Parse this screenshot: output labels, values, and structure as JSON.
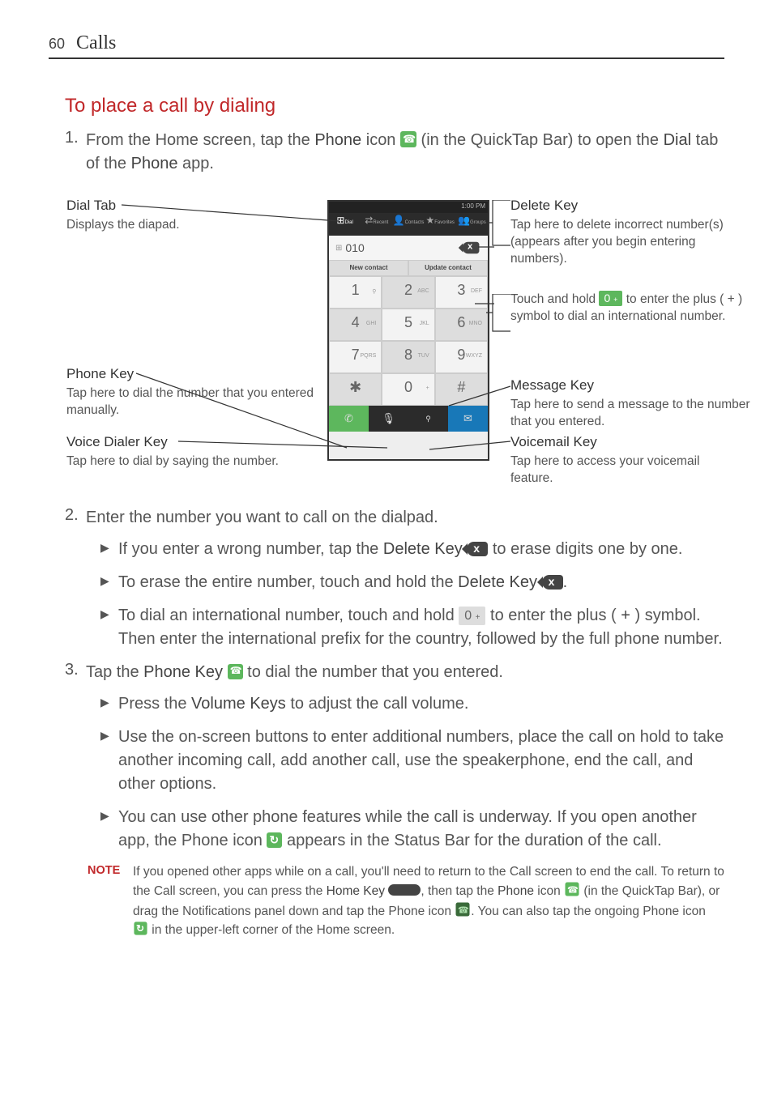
{
  "page": {
    "number": "60",
    "section": "Calls"
  },
  "heading": "To place a call by dialing",
  "step1": {
    "num": "1.",
    "pre": "From the Home screen, tap the ",
    "phone": "Phone",
    "mid": " icon ",
    "after_icon": " (in the QuickTap Bar) to open the ",
    "dial": "Dial",
    "mid2": " tab of the ",
    "phone2": "Phone",
    "end": " app."
  },
  "diagram": {
    "statusbar_time": "1:00 PM",
    "tabs": {
      "dial": "Dial",
      "recent": "Recent",
      "contacts": "Contacts",
      "favorites": "Favorites",
      "groups": "Groups"
    },
    "display_number": "010",
    "actions": {
      "new": "New contact",
      "update": "Update contact"
    },
    "keys": {
      "1": "1",
      "2": "2",
      "2s": "ABC",
      "3": "3",
      "3s": "DEF",
      "4": "4",
      "4s": "GHI",
      "5": "5",
      "5s": "JKL",
      "6": "6",
      "6s": "MNO",
      "7": "7",
      "7s": "PQRS",
      "8": "8",
      "8s": "TUV",
      "9": "9",
      "9s": "WXYZ",
      "star": "✱",
      "0": "0",
      "0s": "+",
      "hash": "#"
    }
  },
  "callouts": {
    "dial_tab": {
      "title": "Dial Tab",
      "desc": "Displays the diapad."
    },
    "phone_key": {
      "title": "Phone Key",
      "desc": "Tap here to dial the number that you entered manually."
    },
    "voice_dialer": {
      "title": "Voice Dialer Key",
      "desc": "Tap here to dial by saying the number."
    },
    "delete_key": {
      "title": "Delete Key",
      "desc": "Tap here to delete incorrect number(s) (appears after you begin entering numbers)."
    },
    "zero_key": {
      "pre": "Touch and hold ",
      "post": " to enter the plus ( + ) symbol to dial an international number."
    },
    "message_key": {
      "title": "Message Key",
      "desc": "Tap here to send a message to the number that you entered."
    },
    "voicemail_key": {
      "title": "Voicemail Key",
      "desc": "Tap here to access your voicemail feature."
    }
  },
  "step2": {
    "num": "2.",
    "text": "Enter the number you want to call on the dialpad."
  },
  "b1": {
    "pre": "If you enter a wrong number, tap the ",
    "bold": "Delete Key",
    "post": " to erase digits one by one."
  },
  "b2": {
    "pre": "To erase the entire number, touch and hold the ",
    "bold": "Delete Key",
    "post": "."
  },
  "b3": {
    "pre": "To dial an international number, touch and hold ",
    "mid": " to enter the plus ( ",
    "plus": "+",
    "mid2": " ) symbol. Then enter the international prefix for the country, followed by the full phone number."
  },
  "step3": {
    "num": "3.",
    "pre": "Tap the ",
    "bold": "Phone Key",
    "post": " to dial the number that you entered."
  },
  "b4": {
    "pre": "Press the ",
    "bold": "Volume Keys",
    "post": " to adjust the call volume."
  },
  "b5": {
    "text": "Use the on-screen buttons to enter additional numbers, place the call on hold to take another incoming call, add another call, use the speakerphone, end the call, and other options."
  },
  "b6": {
    "pre": "You can use other phone features while the call is underway. If you open another app, the Phone icon ",
    "post": " appears in the Status Bar for the duration of the call."
  },
  "note": {
    "label": "NOTE",
    "l1a": "If you opened other apps while on a call, you'll need to return to the Call screen to end the call. To return to the Call screen, you can press the ",
    "home_key": "Home Key",
    "l1b": ", then tap the ",
    "phone": "Phone",
    "l1c": " icon ",
    "l1d": " (in the QuickTap Bar), or drag the Notifications panel down and tap the Phone icon ",
    "l1e": ". You can also tap the ongoing Phone icon ",
    "l1f": " in the upper-left corner of the Home screen."
  }
}
